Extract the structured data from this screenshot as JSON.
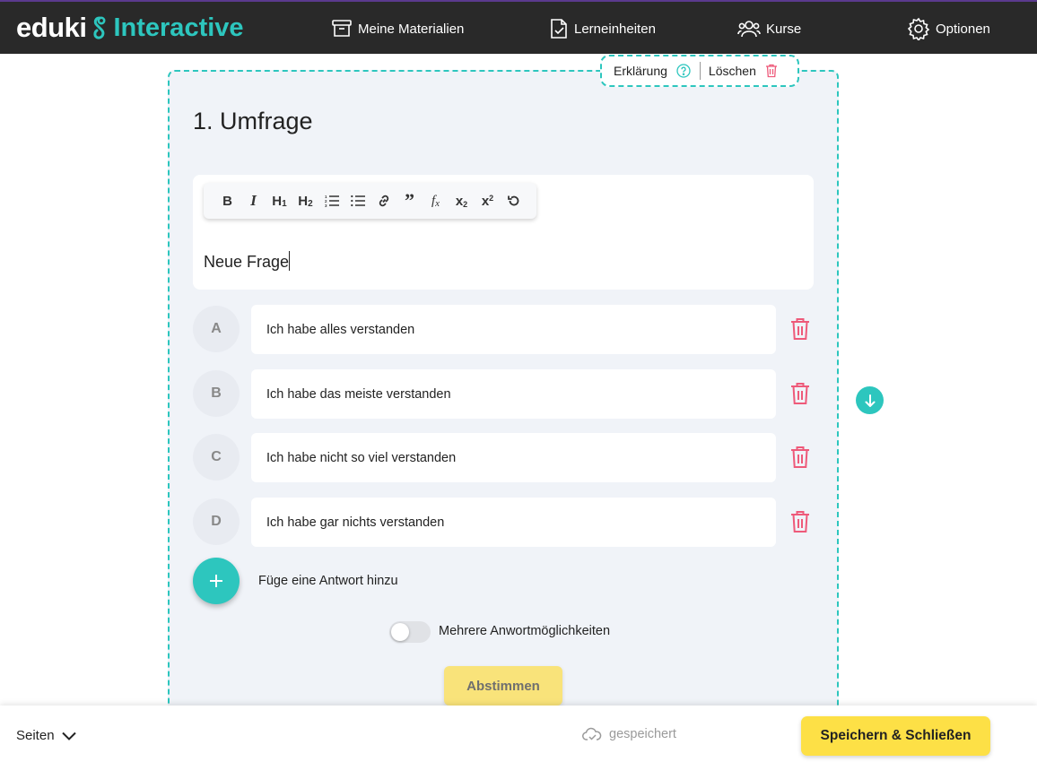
{
  "brand": {
    "name": "eduki",
    "product": "Interactive"
  },
  "nav": [
    {
      "label": "Meine Materialien",
      "icon": "archive-box-icon"
    },
    {
      "label": "Lerneinheiten",
      "icon": "document-check-icon"
    },
    {
      "label": "Kurse",
      "icon": "users-icon"
    },
    {
      "label": "Optionen",
      "icon": "gear-icon"
    }
  ],
  "card_actions": {
    "explain_label": "Erklärung",
    "delete_label": "Löschen"
  },
  "survey": {
    "title": "1. Umfrage",
    "question": "Neue Frage"
  },
  "toolbar": {
    "buttons": [
      "bold",
      "italic",
      "heading-1",
      "heading-2",
      "ordered-list",
      "bullet-list",
      "link",
      "quote",
      "formula",
      "subscript",
      "superscript",
      "undo"
    ]
  },
  "answers": [
    {
      "letter": "A",
      "text": "Ich habe alles verstanden"
    },
    {
      "letter": "B",
      "text": "Ich habe das meiste verstanden"
    },
    {
      "letter": "C",
      "text": "Ich habe nicht so viel verstanden"
    },
    {
      "letter": "D",
      "text": "Ich habe gar nichts verstanden"
    }
  ],
  "add_answer_label": "Füge eine Antwort hinzu",
  "multiple_choice": {
    "label": "Mehrere Anwortmöglichkeiten",
    "enabled": false
  },
  "vote_label": "Abstimmen",
  "bottom": {
    "pages_label": "Seiten",
    "status_label": "gespeichert",
    "save_close_label": "Speichern & Schließen"
  },
  "colors": {
    "accent": "#2dc6be",
    "topbar": "#292929",
    "danger": "#ee5a7a",
    "save_yellow": "#fde046"
  }
}
